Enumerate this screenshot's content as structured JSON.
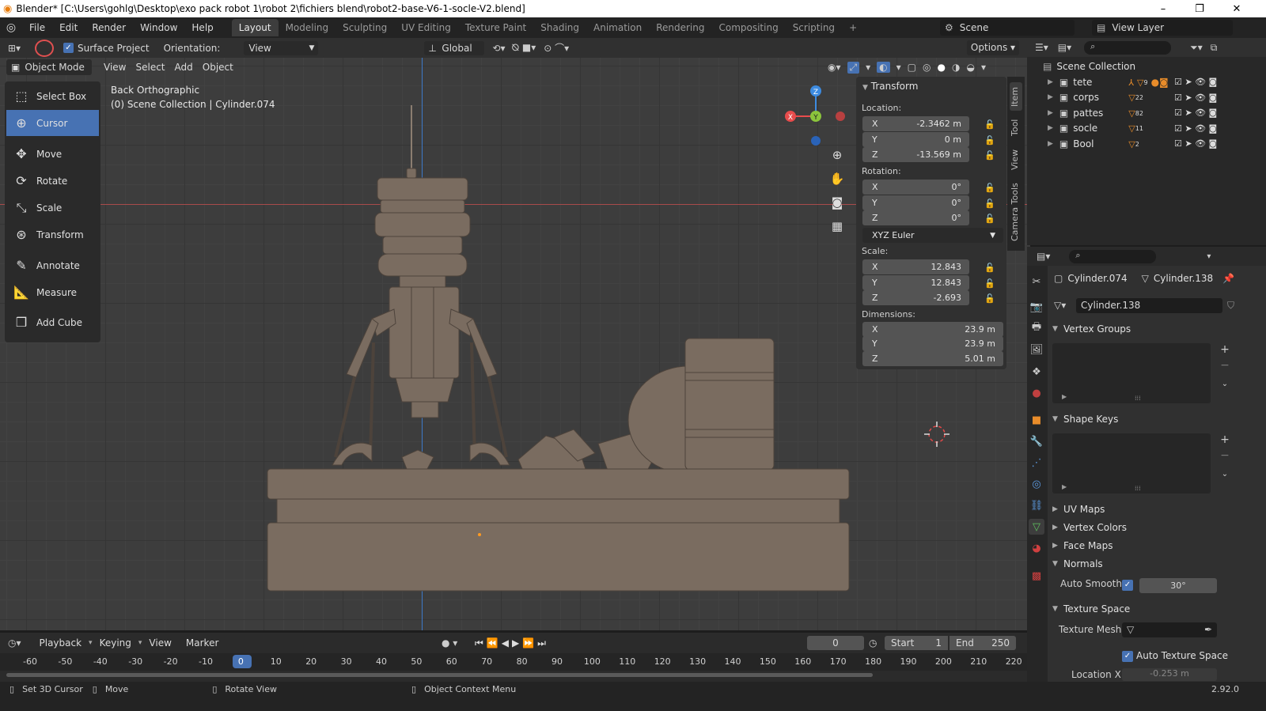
{
  "window": {
    "title": "Blender* [C:\\Users\\gohlg\\Desktop\\exo pack robot 1\\robot 2\\fichiers blend\\robot2-base-V6-1-socle-V2.blend]",
    "minimize": "–",
    "maximize": "❐",
    "close": "✕"
  },
  "menu": {
    "items": [
      "File",
      "Edit",
      "Render",
      "Window",
      "Help"
    ]
  },
  "workspaces": {
    "tabs": [
      "Layout",
      "Modeling",
      "Sculpting",
      "UV Editing",
      "Texture Paint",
      "Shading",
      "Animation",
      "Rendering",
      "Compositing",
      "Scripting"
    ],
    "active": "Layout",
    "add": "+"
  },
  "scene": {
    "name": "Scene",
    "view_layer": "View Layer"
  },
  "toolbar": {
    "surface_project": "Surface Project",
    "orientation_label": "Orientation:",
    "orientation_value": "View",
    "transform_orientation": "Global",
    "options": "Options"
  },
  "viewport_header": {
    "mode": "Object Mode",
    "menus": [
      "View",
      "Select",
      "Add",
      "Object"
    ]
  },
  "viewport": {
    "view_name": "Back Orthographic",
    "collection_info": "(0) Scene Collection | Cylinder.074"
  },
  "gizmo": {
    "x": "X",
    "y": "Y",
    "z": "Z"
  },
  "tools": [
    "Select Box",
    "Cursor",
    "Move",
    "Rotate",
    "Scale",
    "Transform",
    "Annotate",
    "Measure",
    "Add Cube"
  ],
  "active_tool": "Cursor",
  "sidebar_tabs": [
    "Item",
    "Tool",
    "View",
    "Camera Tools"
  ],
  "transform": {
    "title": "Transform",
    "location_label": "Location:",
    "location": [
      {
        "axis": "X",
        "value": "-2.3462 m"
      },
      {
        "axis": "Y",
        "value": "0 m"
      },
      {
        "axis": "Z",
        "value": "-13.569 m"
      }
    ],
    "rotation_label": "Rotation:",
    "rotation": [
      {
        "axis": "X",
        "value": "0°"
      },
      {
        "axis": "Y",
        "value": "0°"
      },
      {
        "axis": "Z",
        "value": "0°"
      }
    ],
    "rotation_mode": "XYZ Euler",
    "scale_label": "Scale:",
    "scale": [
      {
        "axis": "X",
        "value": "12.843"
      },
      {
        "axis": "Y",
        "value": "12.843"
      },
      {
        "axis": "Z",
        "value": "-2.693"
      }
    ],
    "dimensions_label": "Dimensions:",
    "dimensions": [
      {
        "axis": "X",
        "value": "23.9 m"
      },
      {
        "axis": "Y",
        "value": "23.9 m"
      },
      {
        "axis": "Z",
        "value": "5.01 m"
      }
    ]
  },
  "outliner": {
    "root": "Scene Collection",
    "collections": [
      {
        "name": "tete",
        "badge": "9"
      },
      {
        "name": "corps",
        "badge": "22"
      },
      {
        "name": "pattes",
        "badge": "82"
      },
      {
        "name": "socle",
        "badge": "11"
      },
      {
        "name": "Bool",
        "badge": "2"
      }
    ]
  },
  "properties": {
    "object_name": "Cylinder.074",
    "mesh_name": "Cylinder.138",
    "data_field": "Cylinder.138",
    "sections": {
      "vertex_groups": "Vertex Groups",
      "shape_keys": "Shape Keys",
      "uv_maps": "UV Maps",
      "vertex_colors": "Vertex Colors",
      "face_maps": "Face Maps",
      "normals": "Normals",
      "texture_space": "Texture Space"
    },
    "auto_smooth_label": "Auto Smooth",
    "auto_smooth_angle": "30°",
    "texture_mesh_label": "Texture Mesh",
    "auto_texture_space": "Auto Texture Space",
    "location_x_label": "Location X",
    "location_x_value": "-0.253 m"
  },
  "timeline": {
    "menus": [
      "Playback",
      "Keying",
      "View",
      "Marker"
    ],
    "current_frame": "0",
    "start_label": "Start",
    "start": "1",
    "end_label": "End",
    "end": "250",
    "ticks": [
      "-60",
      "-50",
      "-40",
      "-30",
      "-20",
      "-10",
      "0",
      "10",
      "20",
      "30",
      "40",
      "50",
      "60",
      "70",
      "80",
      "90",
      "100",
      "110",
      "120",
      "130",
      "140",
      "150",
      "160",
      "170",
      "180",
      "190",
      "200",
      "210",
      "220"
    ]
  },
  "statusbar": {
    "set_cursor": "Set 3D Cursor",
    "move": "Move",
    "rotate_view": "Rotate View",
    "context_menu": "Object Context Menu",
    "version": "2.92.0"
  },
  "colors": {
    "accent": "#4772b3",
    "x_axis": "#e84c4c",
    "y_axis": "#8bc43c",
    "z_axis": "#3d8be0",
    "model": "#7a6c60"
  }
}
